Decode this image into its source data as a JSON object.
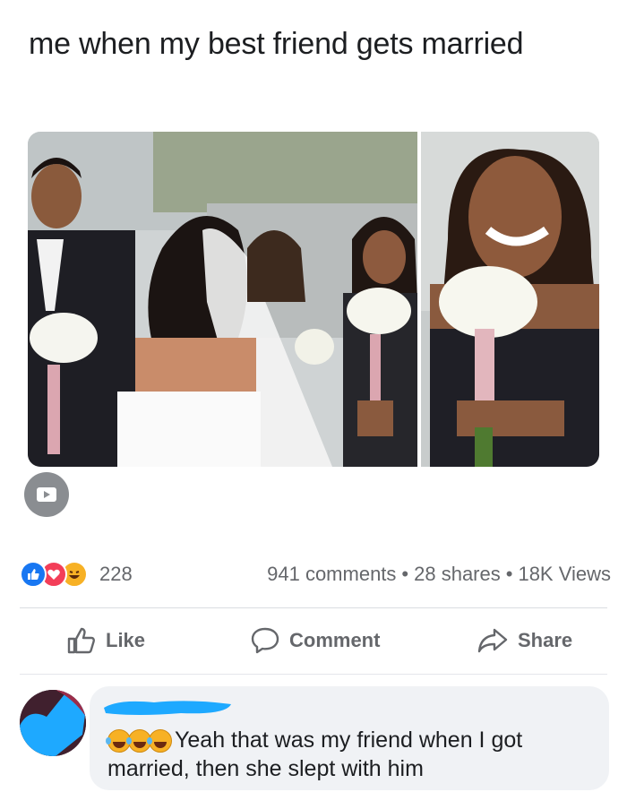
{
  "post": {
    "text": "me when my best friend gets married"
  },
  "media": {
    "video_icon": "video-tv-icon"
  },
  "stats": {
    "reactions": [
      "like",
      "love",
      "haha"
    ],
    "reaction_count": "228",
    "comments": "941 comments",
    "shares": "28 shares",
    "views": "18K Views",
    "separator": "•"
  },
  "actions": {
    "like": "Like",
    "comment": "Comment",
    "share": "Share"
  },
  "comment": {
    "line1": "Yeah that was my friend when I got",
    "line2": "married, then she slept with him",
    "emojis": [
      "rofl",
      "rofl",
      "rofl"
    ]
  },
  "colors": {
    "accent": "#1877f2",
    "love": "#f33e58",
    "haha": "#f7b125",
    "muted_text": "#65676b",
    "redaction": "#1ea9ff"
  }
}
